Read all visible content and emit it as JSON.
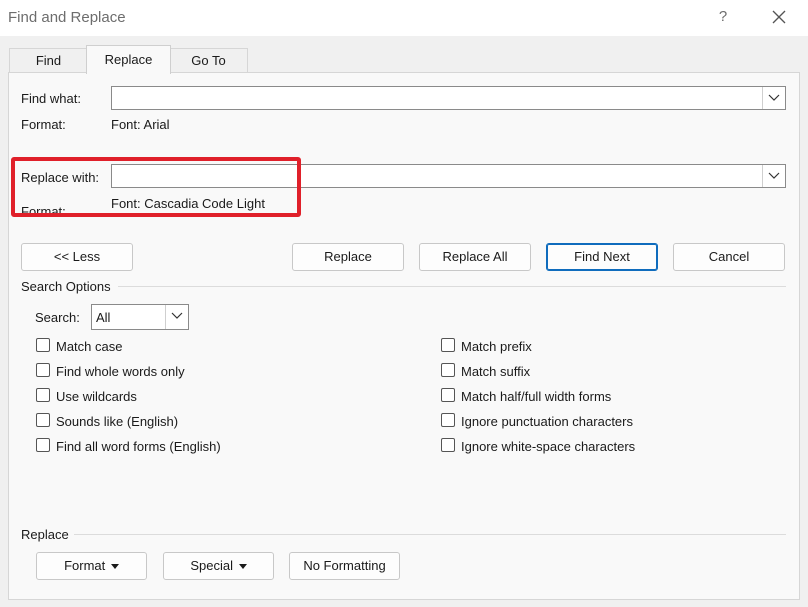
{
  "window": {
    "title": "Find and Replace",
    "help_glyph": "?",
    "close_glyph": "×"
  },
  "tabs": [
    {
      "label": "Find",
      "active": false
    },
    {
      "label": "Replace",
      "active": true
    },
    {
      "label": "Go To",
      "active": false
    }
  ],
  "find": {
    "label": "Find what:",
    "value": "",
    "format_label": "Format:",
    "format_value": "Font: Arial"
  },
  "replace": {
    "label": "Replace with:",
    "value": "",
    "format_label": "Format:",
    "format_value": "Font: Cascadia Code Light"
  },
  "buttons": {
    "less": "<< Less",
    "replace": "Replace",
    "replace_all": "Replace All",
    "find_next": "Find Next",
    "cancel": "Cancel"
  },
  "search_options": {
    "heading": "Search Options",
    "search_label": "Search:",
    "search_value": "All",
    "left": [
      {
        "label": "Match case",
        "checked": false
      },
      {
        "label": "Find whole words only",
        "checked": false
      },
      {
        "label": "Use wildcards",
        "checked": false
      },
      {
        "label": "Sounds like (English)",
        "checked": false
      },
      {
        "label": "Find all word forms (English)",
        "checked": false
      }
    ],
    "right": [
      {
        "label": "Match prefix",
        "checked": false
      },
      {
        "label": "Match suffix",
        "checked": false
      },
      {
        "label": "Match half/full width forms",
        "checked": false
      },
      {
        "label": "Ignore punctuation characters",
        "checked": false
      },
      {
        "label": "Ignore white-space characters",
        "checked": false
      }
    ]
  },
  "replace_section": {
    "heading": "Replace",
    "format_button": "Format",
    "special_button": "Special",
    "no_formatting_button": "No Formatting"
  },
  "colors": {
    "highlight": "#e0202a",
    "default_button_border": "#0f6cbd"
  }
}
